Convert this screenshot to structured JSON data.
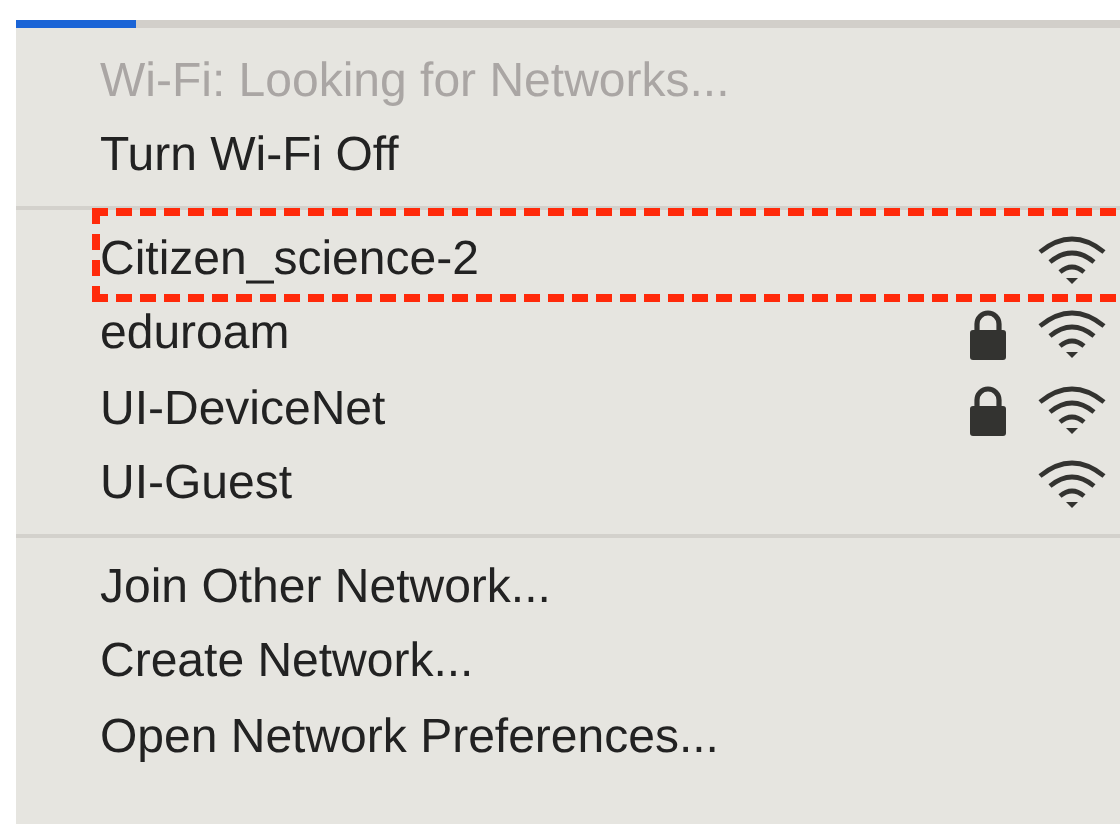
{
  "menu": {
    "status": "Wi-Fi: Looking for Networks...",
    "toggle": "Turn Wi-Fi Off",
    "networks": [
      {
        "name": "Citizen_science-2",
        "secured": false,
        "highlighted": true
      },
      {
        "name": "eduroam",
        "secured": true,
        "highlighted": false
      },
      {
        "name": "UI-DeviceNet",
        "secured": true,
        "highlighted": false
      },
      {
        "name": "UI-Guest",
        "secured": false,
        "highlighted": false
      }
    ],
    "actions": [
      "Join Other Network...",
      "Create Network...",
      "Open Network Preferences..."
    ]
  }
}
